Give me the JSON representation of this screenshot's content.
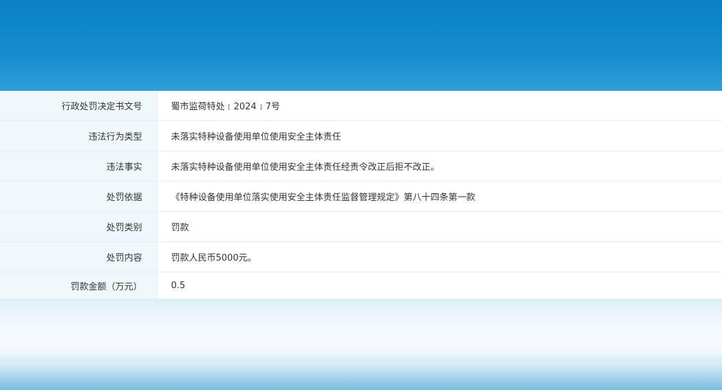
{
  "record": {
    "rows": [
      {
        "label": "行政处罚决定书文号",
        "value": "蜀市监荷特处﹝2024﹞7号"
      },
      {
        "label": "违法行为类型",
        "value": "未落实特种设备使用单位使用安全主体责任"
      },
      {
        "label": "违法事实",
        "value": "未落实特种设备使用单位使用安全主体责任经责令改正后拒不改正。"
      },
      {
        "label": "处罚依据",
        "value": "《特种设备使用单位落实使用安全主体责任监督管理规定》第八十四条第一款"
      },
      {
        "label": "处罚类别",
        "value": "罚款"
      },
      {
        "label": "处罚内容",
        "value": "罚款人民币5000元。"
      },
      {
        "label": "罚款金额（万元）",
        "value": "0.5"
      }
    ]
  }
}
